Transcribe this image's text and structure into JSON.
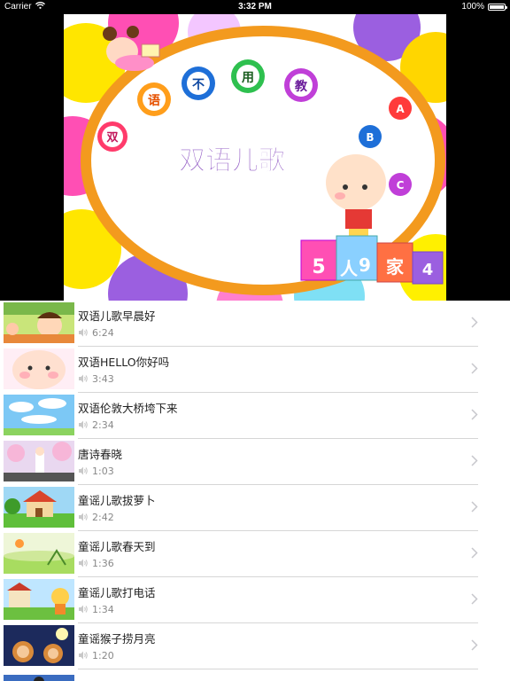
{
  "status_bar": {
    "carrier": "Carrier",
    "time": "3:32 PM",
    "battery": "100%"
  },
  "player": {
    "title_text": "双语儿歌",
    "ball_chars": [
      "双",
      "语",
      "不",
      "用",
      "教"
    ],
    "abc_letters": [
      "A",
      "B",
      "C"
    ],
    "block_chars": [
      "5",
      "人",
      "9",
      "家",
      "4"
    ]
  },
  "songs": [
    {
      "title": "双语儿歌早晨好",
      "duration": "6:24"
    },
    {
      "title": "双语HELLO你好吗",
      "duration": "3:43"
    },
    {
      "title": "双语伦敦大桥垮下来",
      "duration": "2:34"
    },
    {
      "title": "唐诗春晓",
      "duration": "1:03"
    },
    {
      "title": "童谣儿歌拔萝卜",
      "duration": "2:42"
    },
    {
      "title": "童谣儿歌春天到",
      "duration": "1:36"
    },
    {
      "title": "童谣儿歌打电话",
      "duration": "1:34"
    },
    {
      "title": "童谣猴子捞月亮",
      "duration": "1:20"
    }
  ],
  "colors": {
    "separator": "#d6d6d6",
    "title_text": "#222222",
    "duration_text": "#888888",
    "oval_border": "#f39a1e",
    "headline": "#8a4fc0"
  }
}
